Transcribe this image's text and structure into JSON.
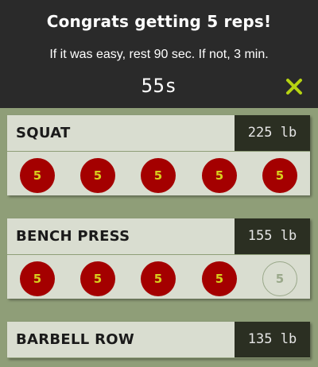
{
  "header": {
    "title": "Congrats getting 5 reps!",
    "subtitle": "If it was easy, rest 90 sec. If not, 3 min.",
    "timer": "55s",
    "close_icon": "close-x-icon",
    "accent_color": "#b6d312"
  },
  "exercises": [
    {
      "name": "SQUAT",
      "weight": "225 lb",
      "sets": [
        {
          "reps": "5",
          "state": "done"
        },
        {
          "reps": "5",
          "state": "done"
        },
        {
          "reps": "5",
          "state": "done"
        },
        {
          "reps": "5",
          "state": "done"
        },
        {
          "reps": "5",
          "state": "done"
        }
      ]
    },
    {
      "name": "BENCH PRESS",
      "weight": "155 lb",
      "sets": [
        {
          "reps": "5",
          "state": "done"
        },
        {
          "reps": "5",
          "state": "done"
        },
        {
          "reps": "5",
          "state": "done"
        },
        {
          "reps": "5",
          "state": "done"
        },
        {
          "reps": "5",
          "state": "todo"
        }
      ]
    },
    {
      "name": "BARBELL ROW",
      "weight": "135 lb"
    }
  ],
  "colors": {
    "background": "#8f9e78",
    "header": "#2a2a2a",
    "card": "#d9ddd0",
    "weight_box": "#2b2f22",
    "set_done": "#a40000",
    "set_done_text": "#d8cf1e"
  }
}
